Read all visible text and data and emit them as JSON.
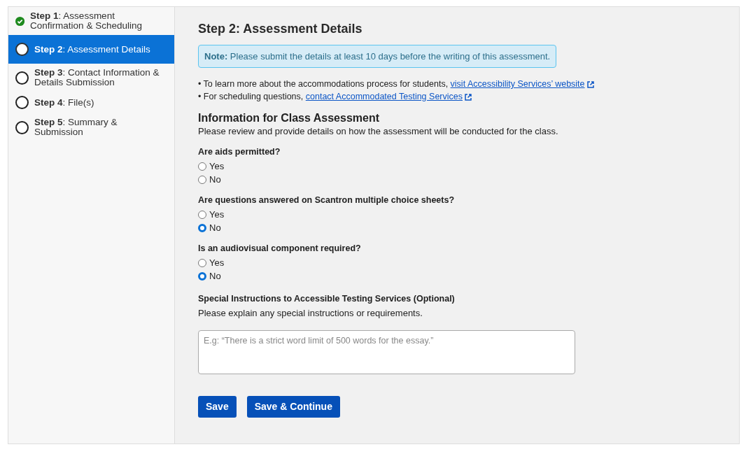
{
  "sidebar": {
    "steps": [
      {
        "label": "**Step 1**: Assessment Confirmation & Scheduling",
        "completed": true,
        "selected": false
      },
      {
        "label": "**Step 2**: Assessment Details",
        "completed": false,
        "selected": true
      },
      {
        "label": "**Step 3**: Contact Information & Details Submission",
        "completed": false,
        "selected": false
      },
      {
        "label": "**Step 4**: File(s)",
        "completed": false,
        "selected": false
      },
      {
        "label": "**Step 5**: Summary & Submission",
        "completed": false,
        "selected": false
      }
    ]
  },
  "main": {
    "title": "Step 2: Assessment Details",
    "note": {
      "label": "Note:",
      "text": "Please submit the details at least 10 days before the writing of this assessment."
    },
    "info_lines": [
      {
        "text": "• To learn more about the accommodations process for students, ",
        "link": "visit Accessibility Services’ website"
      },
      {
        "text": "• For scheduling questions, ",
        "link": "contact Accommodated Testing Services"
      }
    ],
    "section_title": "Information for Class Assessment",
    "section_description": "Please review and provide details on how the assessment will be conducted for the class.",
    "questions": [
      {
        "label": "Are aids permitted?",
        "options": [
          {
            "label": "Yes",
            "selected": false
          },
          {
            "label": "No",
            "selected": false
          }
        ]
      },
      {
        "label": "Are questions answered on Scantron multiple choice sheets?",
        "options": [
          {
            "label": "Yes",
            "selected": false
          },
          {
            "label": "No",
            "selected": true
          }
        ]
      },
      {
        "label": "Is an audiovisual component required?",
        "options": [
          {
            "label": "Yes",
            "selected": false
          },
          {
            "label": "No",
            "selected": true
          }
        ]
      }
    ],
    "instructions": {
      "label": "Special Instructions to Accessible Testing Services (Optional)",
      "description": "Please explain any special instructions or requirements.",
      "placeholder": "E.g: “There is a strict word limit of 500 words for the essay.”"
    },
    "buttons": [
      "Save",
      "Save & Continue"
    ]
  }
}
